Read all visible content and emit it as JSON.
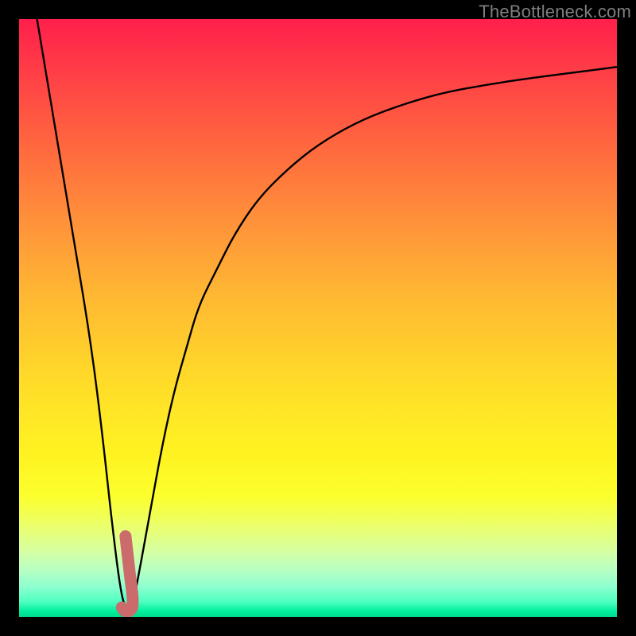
{
  "watermark": "TheBottleneck.com",
  "colors": {
    "frame": "#000000",
    "curve": "#000000",
    "marker": "#cc6b6b",
    "gradient_top": "#ff1f4b",
    "gradient_bottom": "#00d88c"
  },
  "chart_data": {
    "type": "line",
    "title": "",
    "xlabel": "",
    "ylabel": "",
    "xlim": [
      0,
      100
    ],
    "ylim": [
      0,
      100
    ],
    "grid": false,
    "series": [
      {
        "name": "bottleneck-curve",
        "x": [
          3,
          6,
          9,
          12,
          14,
          15.5,
          17,
          18,
          19,
          20,
          22,
          24,
          26,
          28,
          30,
          33,
          36,
          40,
          45,
          50,
          56,
          62,
          70,
          78,
          86,
          94,
          100
        ],
        "y": [
          100,
          82,
          64,
          46,
          30,
          16,
          4,
          1,
          2,
          7,
          18,
          29,
          38,
          45,
          52,
          58,
          64,
          70,
          75,
          79,
          82.5,
          85,
          87.5,
          89,
          90.2,
          91.2,
          92
        ]
      }
    ],
    "marker": {
      "name": "current-config",
      "path_x": [
        17.8,
        18.2,
        18.6,
        19.0,
        19.0,
        18.9,
        18.5,
        18.0,
        17.5,
        17.2
      ],
      "path_y": [
        13.5,
        10.0,
        6.5,
        3.5,
        2.2,
        1.4,
        1.0,
        0.9,
        1.1,
        1.6
      ]
    }
  }
}
